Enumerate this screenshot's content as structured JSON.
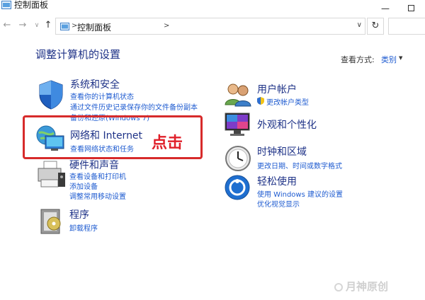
{
  "window": {
    "title": "控制面板"
  },
  "address_bar": {
    "breadcrumb": "控制面板",
    "separator": ">",
    "separator_end": ">",
    "dropdown": "∨",
    "refresh": "↻",
    "back": "←",
    "forward": "→",
    "recent": "∨",
    "up": "↑"
  },
  "main": {
    "title": "调整计算机的设置",
    "view_by_label": "查看方式:",
    "view_by_value": "类别"
  },
  "categories": {
    "system": {
      "title": "系统和安全",
      "links": [
        "查看你的计算机状态",
        "通过文件历史记录保存你的文件备份副本",
        "备份和还原(Windows 7)"
      ]
    },
    "network": {
      "title": "网络和 Internet",
      "links": [
        "查看网络状态和任务"
      ]
    },
    "hardware": {
      "title": "硬件和声音",
      "links": [
        "查看设备和打印机",
        "添加设备",
        "调整常用移动设置"
      ]
    },
    "programs": {
      "title": "程序",
      "links": [
        "卸载程序"
      ]
    },
    "accounts": {
      "title": "用户帐户",
      "links": [
        "更改帐户类型"
      ]
    },
    "appearance": {
      "title": "外观和个性化",
      "links": []
    },
    "clock": {
      "title": "时钟和区域",
      "links": [
        "更改日期、时间或数字格式"
      ]
    },
    "ease": {
      "title": "轻松使用",
      "links": [
        "使用 Windows 建议的设置",
        "优化视觉显示"
      ]
    }
  },
  "annotation": {
    "callout": "点击"
  },
  "watermark": {
    "text": "月神原创"
  },
  "colors": {
    "heading": "#1e3287",
    "link": "#1e5bd0",
    "callout": "#d72b2b"
  }
}
